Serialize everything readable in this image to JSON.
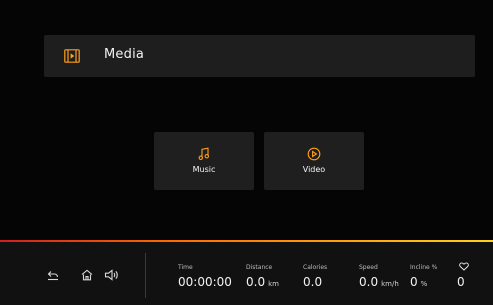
{
  "header": {
    "title": "Media",
    "icon": "media-icon",
    "accent": "#ff9f1a"
  },
  "tiles": [
    {
      "label": "Music",
      "icon": "music-note-icon"
    },
    {
      "label": "Video",
      "icon": "play-circle-icon"
    }
  ],
  "nav": {
    "back_icon": "back-icon",
    "home_icon": "home-icon",
    "volume_icon": "volume-icon"
  },
  "stats": {
    "time": {
      "label": "Time",
      "value": "00:00:00"
    },
    "distance": {
      "label": "Distance",
      "value": "0.0",
      "unit": "km"
    },
    "calories": {
      "label": "Calories",
      "value": "0.0"
    },
    "speed": {
      "label": "Speed",
      "value": "0.0",
      "unit": "km/h"
    },
    "incline": {
      "label": "Incline %",
      "value": "0",
      "unit": "%"
    },
    "heart_rate": {
      "value": "0",
      "icon": "heart-icon"
    }
  },
  "colors": {
    "background": "#050505",
    "panel": "#1e1e1e",
    "accent": "#ff9f1a",
    "gradient_start": "#d11f1f",
    "gradient_end": "#ffd21a"
  }
}
